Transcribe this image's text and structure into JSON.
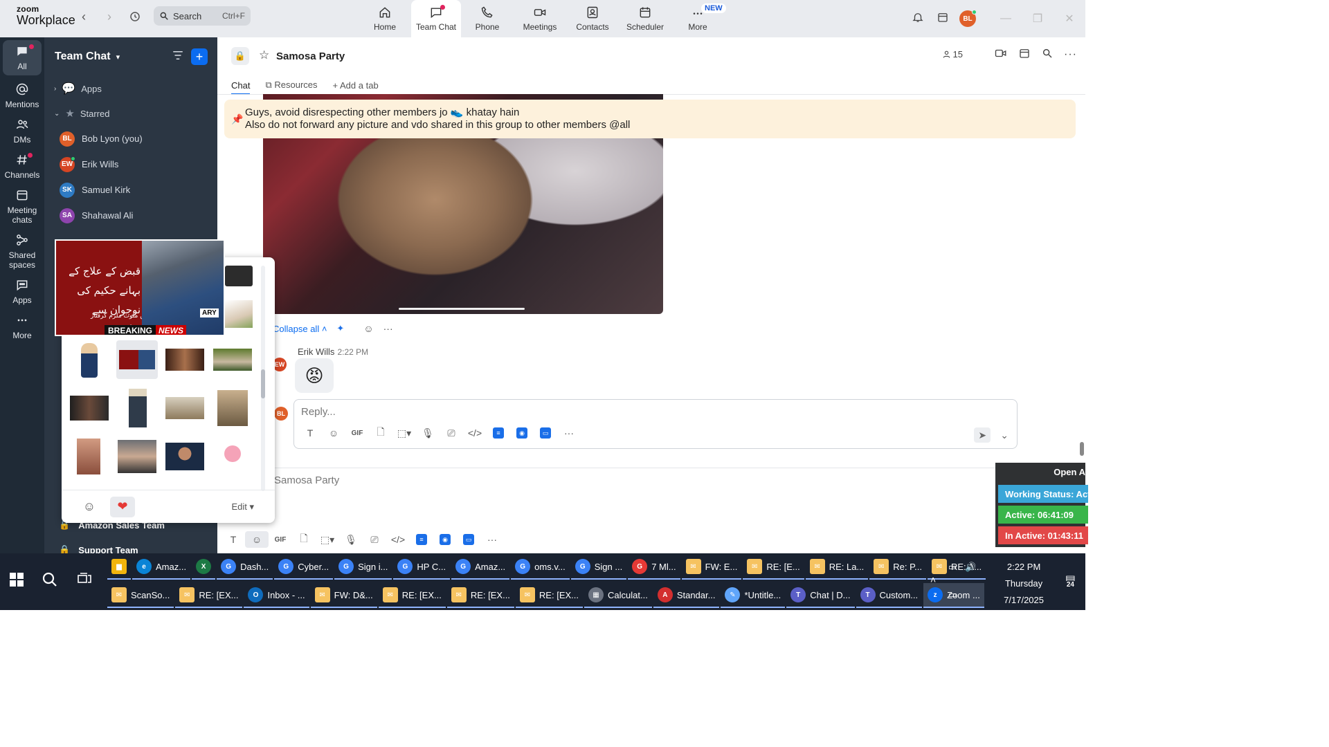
{
  "app": {
    "brand_top": "zoom",
    "brand_bottom": "Workplace",
    "search_label": "Search",
    "search_shortcut": "Ctrl+F",
    "nav": [
      {
        "label": "Home",
        "icon": "home-icon"
      },
      {
        "label": "Team Chat",
        "icon": "chat-icon",
        "active": true
      },
      {
        "label": "Phone",
        "icon": "phone-icon"
      },
      {
        "label": "Meetings",
        "icon": "video-icon"
      },
      {
        "label": "Contacts",
        "icon": "contacts-icon"
      },
      {
        "label": "Scheduler",
        "icon": "calendar-icon"
      },
      {
        "label": "More",
        "icon": "more-icon"
      }
    ],
    "new_badge": "NEW",
    "user_initials": "BL"
  },
  "rail": [
    {
      "label": "All",
      "icon": "chat-icon"
    },
    {
      "label": "Mentions",
      "icon": "at-icon"
    },
    {
      "label": "DMs",
      "icon": "people-icon"
    },
    {
      "label": "Channels",
      "icon": "hash-icon"
    },
    {
      "label": "Meeting chats",
      "icon": "calendar-icon"
    },
    {
      "label": "Shared spaces",
      "icon": "share-icon"
    },
    {
      "label": "Apps",
      "icon": "apps-icon"
    },
    {
      "label": "More",
      "icon": "more-icon"
    }
  ],
  "panel": {
    "title": "Team Chat",
    "apps_label": "Apps",
    "starred_label": "Starred",
    "contacts": [
      {
        "name": "Bob Lyon (you)",
        "initials": "BL",
        "color": "#e0602a"
      },
      {
        "name": "Erik Wills",
        "initials": "EW",
        "color": "#d64523"
      },
      {
        "name": "Samuel Kirk",
        "initials": "SK",
        "color": "#2e7bc4"
      },
      {
        "name": "Shahawal Ali",
        "initials": "SA",
        "color": "#8e44ad"
      }
    ],
    "lower_items": [
      "Amazon Sales Team",
      "Support Team"
    ]
  },
  "picker": {
    "preview_headline": "قبض کے علاج کے بہانے حکیم کی نوجوان سے زیادتی",
    "preview_sub": "خواتین پر تشدد میں ملوث ملزم گرفتار",
    "preview_breaking": "BREAKING",
    "preview_news": "NEWS",
    "preview_logo": "ARY",
    "edit_label": "Edit ▾"
  },
  "channel": {
    "name": "Samosa Party",
    "member_count": "15",
    "tabs": [
      "Chat",
      "Resources",
      "Add a tab"
    ],
    "pinned_line1": "Guys, avoid disrespecting other members jo 👟 khatay hain",
    "pinned_line2": "Also do not forward any picture and vdo shared in this group to other members @all",
    "collapse_label": "Collapse all",
    "message": {
      "sender": "Erik Wills",
      "time": "2:22 PM",
      "initials": "EW",
      "emoji": "😡"
    },
    "reply_placeholder": "Reply...",
    "reply_initials": "BL",
    "compose_placeholder": "Samosa Party"
  },
  "status_widget": {
    "open": "Open A",
    "working": "Working Status: Acti",
    "active": "Active: 06:41:09",
    "inactive": "In Active: 01:43:11"
  },
  "taskbar": {
    "row1": [
      {
        "label": "",
        "icon": "folder",
        "color": "#f2b40d"
      },
      {
        "label": "Amaz...",
        "icon": "edge",
        "color": "#0a84d6"
      },
      {
        "label": "",
        "icon": "excel",
        "color": "#1d7a45"
      },
      {
        "label": "Dash...",
        "icon": "chrome",
        "color": "#3b82f6"
      },
      {
        "label": "Cyber...",
        "icon": "chrome",
        "color": "#3b82f6"
      },
      {
        "label": "Sign i...",
        "icon": "chrome",
        "color": "#3b82f6"
      },
      {
        "label": "HP C...",
        "icon": "chrome",
        "color": "#3b82f6"
      },
      {
        "label": "Amaz...",
        "icon": "chrome",
        "color": "#3b82f6"
      },
      {
        "label": "oms.v...",
        "icon": "chrome",
        "color": "#3b82f6"
      },
      {
        "label": "Sign ...",
        "icon": "chrome",
        "color": "#3b82f6"
      },
      {
        "label": "7 Ml...",
        "icon": "chrome",
        "color": "#e53935"
      },
      {
        "label": "FW: E...",
        "icon": "mail",
        "color": "#f6c361"
      },
      {
        "label": "RE: [E...",
        "icon": "mail",
        "color": "#f6c361"
      },
      {
        "label": "RE: La...",
        "icon": "mail",
        "color": "#f6c361"
      },
      {
        "label": "Re: P...",
        "icon": "mail",
        "color": "#f6c361"
      },
      {
        "label": "RE: A...",
        "icon": "mail",
        "color": "#f6c361"
      }
    ],
    "row2": [
      {
        "label": "ScanSo...",
        "icon": "mail",
        "color": "#f6c361"
      },
      {
        "label": "RE: [EX...",
        "icon": "mail",
        "color": "#f6c361"
      },
      {
        "label": "Inbox - ...",
        "icon": "outlook",
        "color": "#0f6cbd"
      },
      {
        "label": "FW: D&...",
        "icon": "mail",
        "color": "#f6c361"
      },
      {
        "label": "RE: [EX...",
        "icon": "mail",
        "color": "#f6c361"
      },
      {
        "label": "RE: [EX...",
        "icon": "mail",
        "color": "#f6c361"
      },
      {
        "label": "RE: [EX...",
        "icon": "mail",
        "color": "#f6c361"
      },
      {
        "label": "Calculat...",
        "icon": "calculator",
        "color": "#6b7280"
      },
      {
        "label": "Standar...",
        "icon": "pdf",
        "color": "#d32f2f"
      },
      {
        "label": "*Untitle...",
        "icon": "notepad",
        "color": "#60a5fa"
      },
      {
        "label": "Chat | D...",
        "icon": "teams",
        "color": "#5b5fc7"
      },
      {
        "label": "Custom...",
        "icon": "teams",
        "color": "#5b5fc7"
      },
      {
        "label": "Zoom ...",
        "icon": "zoom",
        "color": "#0b6cf0",
        "active": true
      }
    ],
    "time": "2:22 PM",
    "day": "Thursday",
    "date": "7/17/2025",
    "notif_count": "24"
  }
}
